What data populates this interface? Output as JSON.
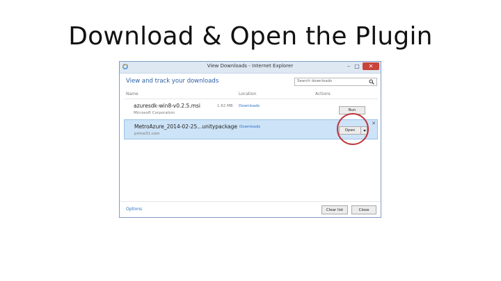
{
  "slide": {
    "title": "Download & Open the Plugin"
  },
  "window": {
    "title": "View Downloads - Internet Explorer",
    "min_glyph": "–",
    "max_glyph": "□",
    "close_glyph": "✕"
  },
  "panel": {
    "header_title": "View and track your downloads",
    "search_placeholder": "Search downloads"
  },
  "columns": {
    "name": "Name",
    "location": "Location",
    "actions": "Actions"
  },
  "downloads": [
    {
      "name": "azuresdk-win8-v0.2.5.msi",
      "publisher": "Microsoft Corporation",
      "size": "1.62 MB",
      "location": "Downloads",
      "action": "Run"
    },
    {
      "name": "MetroAzure_2014-02-25...unitypackage",
      "publisher": "prime31.com",
      "size": "",
      "location": "Downloads",
      "action": "Open",
      "close_glyph": "✕"
    }
  ],
  "footer": {
    "options": "Options",
    "clear_list": "Clear list",
    "close": "Close"
  },
  "colors": {
    "accent": "#2a5fa6",
    "selected_row": "#cde3f7",
    "highlight_circle": "#c0343b",
    "close_button": "#c9443a"
  }
}
